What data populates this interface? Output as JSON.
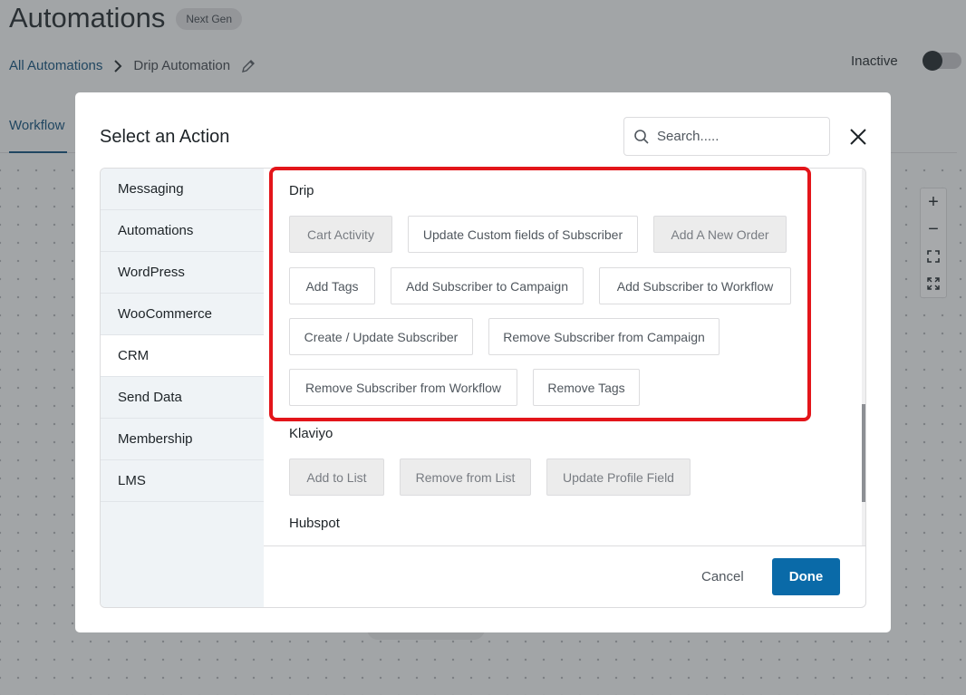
{
  "page": {
    "title": "Automations",
    "badge": "Next Gen",
    "breadcrumb": {
      "root": "All Automations",
      "current": "Drip Automation"
    },
    "status_label": "Inactive",
    "tab": "Workflow"
  },
  "modal": {
    "title": "Select an Action",
    "search_placeholder": "Search.....",
    "categories": [
      {
        "label": "Messaging"
      },
      {
        "label": "Automations"
      },
      {
        "label": "WordPress"
      },
      {
        "label": "WooCommerce"
      },
      {
        "label": "CRM",
        "active": true
      },
      {
        "label": "Send Data"
      },
      {
        "label": "Membership"
      },
      {
        "label": "LMS"
      }
    ],
    "groups": [
      {
        "title": "Drip",
        "actions": [
          {
            "label": "Cart Activity",
            "disabled": true
          },
          {
            "label": "Update Custom fields of Subscriber",
            "disabled": false
          },
          {
            "label": "Add A New Order",
            "disabled": true
          },
          {
            "label": "Add Tags",
            "disabled": false
          },
          {
            "label": "Add Subscriber to Campaign",
            "disabled": false
          },
          {
            "label": "Add Subscriber to Workflow",
            "disabled": false
          },
          {
            "label": "Create / Update Subscriber",
            "disabled": false
          },
          {
            "label": "Remove Subscriber from Campaign",
            "disabled": false
          },
          {
            "label": "Remove Subscriber from Workflow",
            "disabled": false
          },
          {
            "label": "Remove Tags",
            "disabled": false
          }
        ]
      },
      {
        "title": "Klaviyo",
        "actions": [
          {
            "label": "Add to List",
            "disabled": true
          },
          {
            "label": "Remove from List",
            "disabled": true
          },
          {
            "label": "Update Profile Field",
            "disabled": true
          }
        ]
      },
      {
        "title": "Hubspot",
        "actions": []
      }
    ],
    "cancel_label": "Cancel",
    "done_label": "Done"
  },
  "colors": {
    "primary": "#0a6aa8",
    "highlight": "#e3151a",
    "link": "#0a4b78"
  }
}
